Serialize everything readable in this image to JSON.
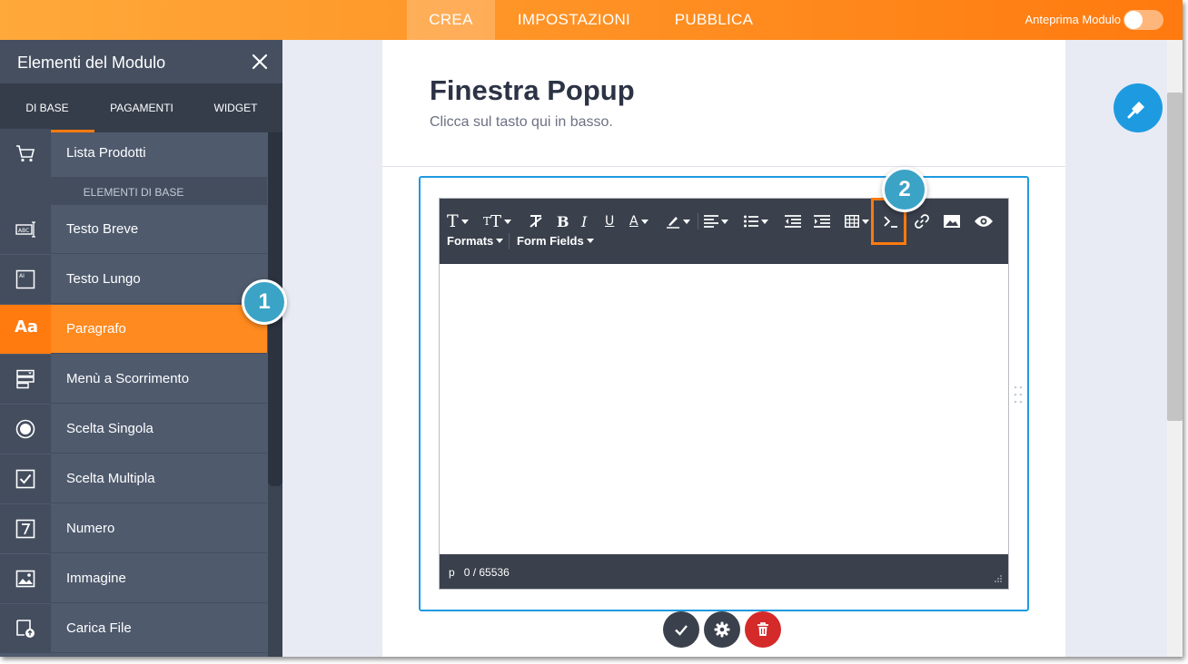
{
  "topbar": {
    "tabs": [
      {
        "label": "CREA",
        "active": true
      },
      {
        "label": "IMPOSTAZIONI",
        "active": false
      },
      {
        "label": "PUBBLICA",
        "active": false
      }
    ],
    "preview_label": "Anteprima Modulo",
    "preview_enabled": false
  },
  "sidebar": {
    "title": "Elementi del Modulo",
    "tabs": [
      "DI BASE",
      "PAGAMENTI",
      "WIDGET"
    ],
    "active_tab": "DI BASE",
    "section_label": "ELEMENTI DI BASE",
    "items": [
      {
        "label": "Lista Prodotti",
        "icon": "shopping-cart-icon"
      },
      {
        "label": "Testo Breve",
        "icon": "short-text-icon"
      },
      {
        "label": "Testo Lungo",
        "icon": "long-text-icon"
      },
      {
        "label": "Paragrafo",
        "icon": "paragraph-icon",
        "active": true
      },
      {
        "label": "Menù a Scorrimento",
        "icon": "dropdown-icon"
      },
      {
        "label": "Scelta Singola",
        "icon": "radio-icon"
      },
      {
        "label": "Scelta Multipla",
        "icon": "checkbox-icon"
      },
      {
        "label": "Numero",
        "icon": "number-icon"
      },
      {
        "label": "Immagine",
        "icon": "image-icon"
      },
      {
        "label": "Carica File",
        "icon": "file-upload-icon"
      }
    ]
  },
  "form": {
    "heading": "Finestra Popup",
    "subheading": "Clicca sul tasto qui in basso."
  },
  "editor": {
    "paragraph_icon_label": "Aa",
    "menus": [
      "Formats",
      "Form Fields"
    ],
    "status_tag": "p",
    "status_count": "0 / 65536",
    "toolbar_icons": [
      "font-family-icon",
      "font-size-icon",
      "clear-format-icon",
      "bold-icon",
      "italic-icon",
      "underline-icon",
      "text-color-icon",
      "highlight-icon",
      "align-icon",
      "list-icon",
      "outdent-icon",
      "indent-icon",
      "table-icon",
      "source-code-icon",
      "link-icon",
      "image-icon",
      "preview-icon"
    ]
  },
  "annotations": {
    "badge_1": "1",
    "badge_2": "2"
  },
  "colors": {
    "accent_orange": "#ff7a0f",
    "sidebar_bg": "#4f5a6d",
    "editor_dark": "#3a404c",
    "focus_blue": "#1e9be0",
    "badge_blue": "#3ba3c6",
    "delete_red": "#d42a2a"
  }
}
